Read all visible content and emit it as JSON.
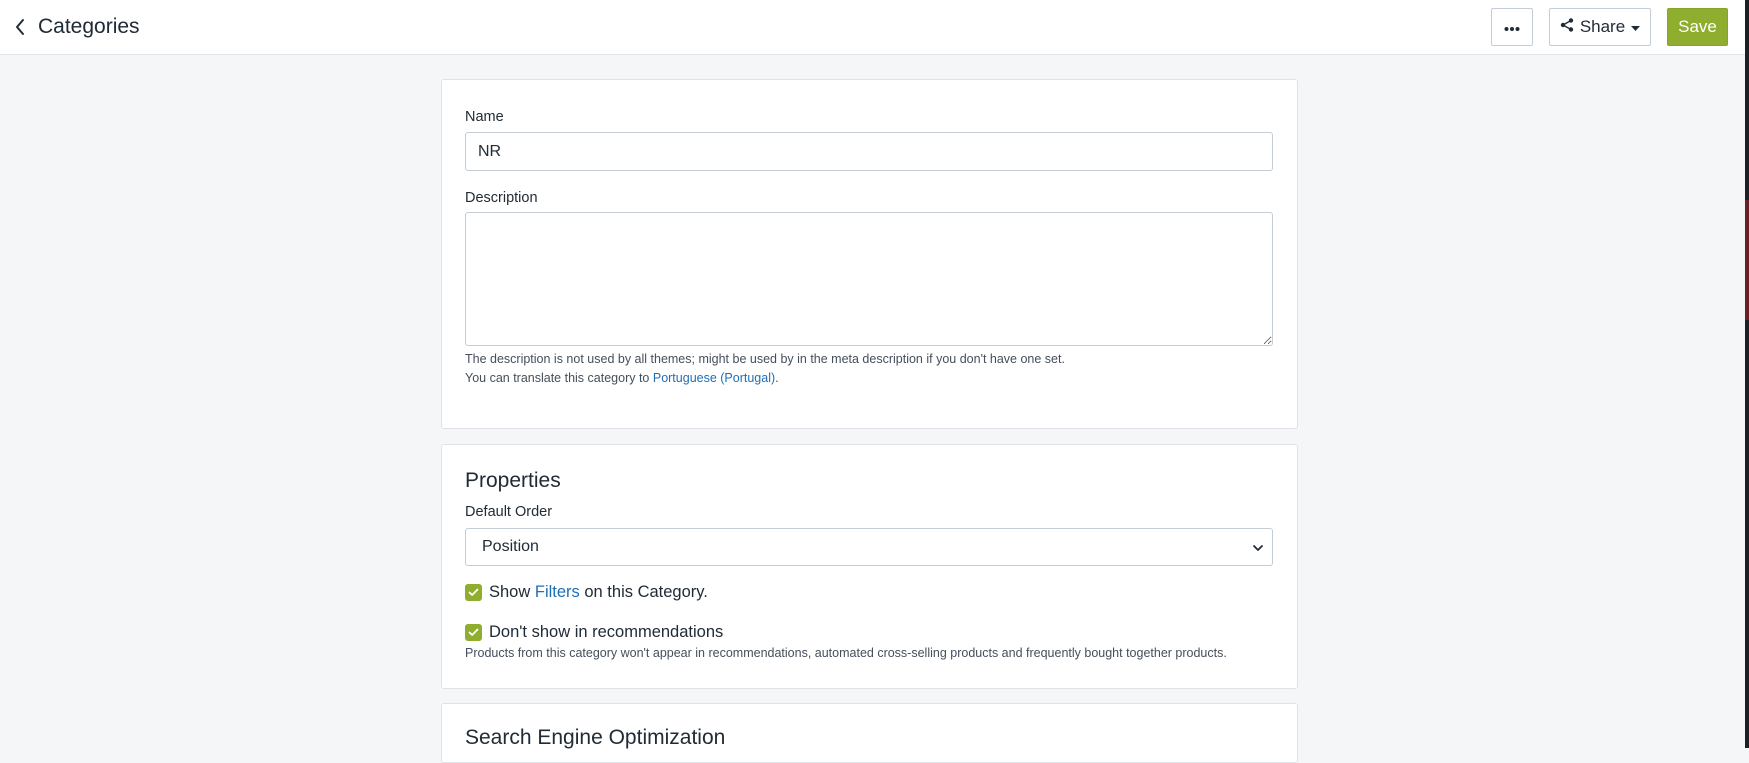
{
  "header": {
    "back_icon": "chevron-left-icon",
    "title": "Categories",
    "more_icon": "ellipsis-icon",
    "share_label": "Share",
    "share_icon": "share-icon",
    "save_label": "Save",
    "accent_color": "#8fad2e"
  },
  "general": {
    "name_label": "Name",
    "name_value": "NR",
    "description_label": "Description",
    "description_value": "",
    "description_help": "The description is not used by all themes; might be used by in the meta description if you don't have one set.",
    "translate_prefix": "You can translate this category to ",
    "translate_link": "Portuguese (Portugal)",
    "translate_suffix": "."
  },
  "properties": {
    "title": "Properties",
    "default_order_label": "Default Order",
    "default_order_value": "Position",
    "show_filters_prefix": "Show ",
    "show_filters_link": "Filters",
    "show_filters_suffix": " on this Category.",
    "show_filters_checked": true,
    "no_recommend_label": "Don't show in recommendations",
    "no_recommend_checked": true,
    "no_recommend_help": "Products from this category won't appear in recommendations, automated cross-selling products and frequently bought together products."
  },
  "seo": {
    "title": "Search Engine Optimization"
  }
}
